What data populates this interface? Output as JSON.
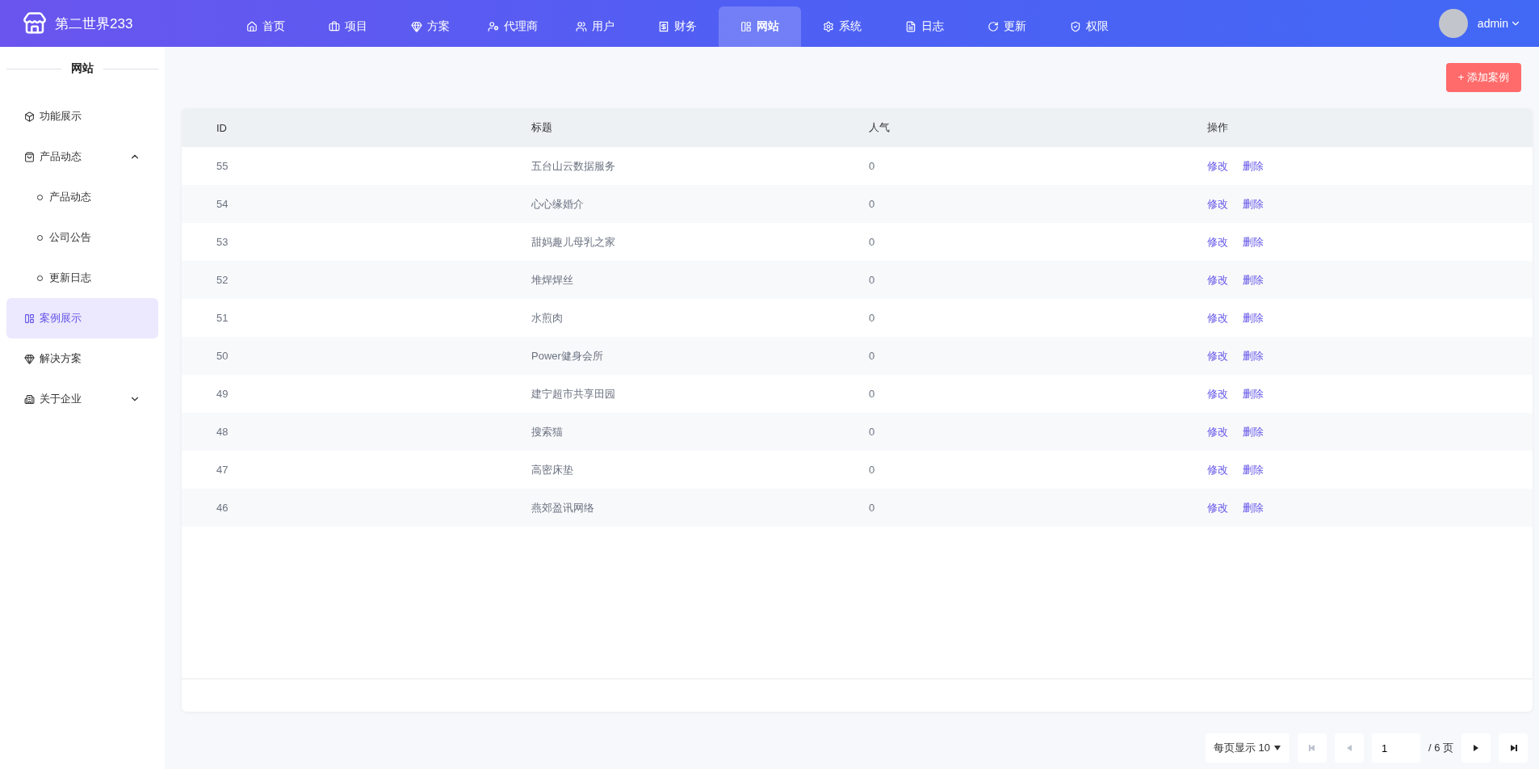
{
  "brand": {
    "name": "第二世界233"
  },
  "nav": [
    {
      "label": "首页",
      "selected": false
    },
    {
      "label": "项目",
      "selected": false
    },
    {
      "label": "方案",
      "selected": false
    },
    {
      "label": "代理商",
      "selected": false
    },
    {
      "label": "用户",
      "selected": false
    },
    {
      "label": "财务",
      "selected": false
    },
    {
      "label": "网站",
      "selected": true
    },
    {
      "label": "系统",
      "selected": false
    },
    {
      "label": "日志",
      "selected": false
    },
    {
      "label": "更新",
      "selected": false
    },
    {
      "label": "权限",
      "selected": false
    }
  ],
  "user": {
    "name": "admin"
  },
  "sidebar": {
    "title": "网站",
    "items": [
      {
        "label": "功能展示",
        "selected": false
      },
      {
        "label": "产品动态",
        "selected": false,
        "expanded": true,
        "children": [
          {
            "label": "产品动态",
            "selected": false
          },
          {
            "label": "公司公告",
            "selected": false
          },
          {
            "label": "更新日志",
            "selected": false
          }
        ]
      },
      {
        "label": "案例展示",
        "selected": true
      },
      {
        "label": "解决方案",
        "selected": false
      },
      {
        "label": "关于企业",
        "selected": false,
        "expanded": false
      }
    ]
  },
  "add_button": "+ 添加案例",
  "table": {
    "columns": [
      "ID",
      "标题",
      "人气",
      "操作"
    ],
    "rows": [
      {
        "id": "55",
        "title": "五台山云数据服务",
        "popularity": "0",
        "actions": [
          "修改",
          "删除"
        ]
      },
      {
        "id": "54",
        "title": "心心缘婚介",
        "popularity": "0",
        "actions": [
          "修改",
          "删除"
        ]
      },
      {
        "id": "53",
        "title": "甜妈趣儿母乳之家",
        "popularity": "0",
        "actions": [
          "修改",
          "删除"
        ]
      },
      {
        "id": "52",
        "title": "堆焊焊丝",
        "popularity": "0",
        "actions": [
          "修改",
          "删除"
        ]
      },
      {
        "id": "51",
        "title": "水煎肉",
        "popularity": "0",
        "actions": [
          "修改",
          "删除"
        ]
      },
      {
        "id": "50",
        "title": "Power健身会所",
        "popularity": "0",
        "actions": [
          "修改",
          "删除"
        ]
      },
      {
        "id": "49",
        "title": "建宁超市共享田园",
        "popularity": "0",
        "actions": [
          "修改",
          "删除"
        ]
      },
      {
        "id": "48",
        "title": "搜索猫",
        "popularity": "0",
        "actions": [
          "修改",
          "删除"
        ]
      },
      {
        "id": "47",
        "title": "高密床垫",
        "popularity": "0",
        "actions": [
          "修改",
          "删除"
        ]
      },
      {
        "id": "46",
        "title": "燕郊盈讯网络",
        "popularity": "0",
        "actions": [
          "修改",
          "删除"
        ]
      }
    ]
  },
  "pagination": {
    "page_size": "每页显示 10",
    "page": "1",
    "total": "/ 6 页",
    "first_disabled": true,
    "prev_disabled": true,
    "next_disabled": false,
    "last_disabled": false
  }
}
